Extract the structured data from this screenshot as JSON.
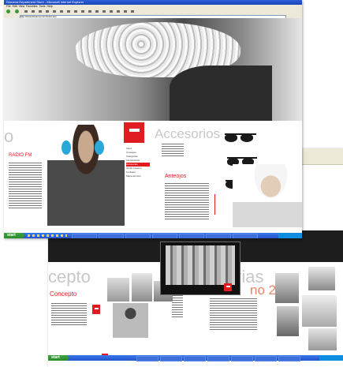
{
  "back_window": {
    "headings": {
      "left": "cepto",
      "middle": "rias",
      "right": "no 2005"
    },
    "left_red_heading": "Concepto",
    "taskbar": {
      "start_label": "start",
      "items": [
        "",
        "",
        "",
        "",
        "",
        "",
        "",
        ""
      ]
    }
  },
  "front_window": {
    "title": "Diorama Department Store - Microsoft Internet Explorer",
    "menu": [
      "File",
      "Edit",
      "View",
      "Favorites",
      "Tools",
      "Help"
    ],
    "address": "http://www.diorama.com/index.asp",
    "page": {
      "left_heading": "o",
      "left_red_text": "RADIO FM",
      "section_heading": "Accesorios",
      "red_subheading": "Anteojos",
      "nav_items": [
        "Inicio",
        "Concepto",
        "Categorias",
        "Lanzamiento",
        "Accesorios",
        "Otoño-Invierno",
        "Contacto",
        "Mapa del sitio"
      ]
    },
    "taskbar": {
      "start_label": "start"
    }
  },
  "colors": {
    "accent_red": "#e01b22",
    "xp_blue": "#2455cc",
    "xp_green": "#3fa33f"
  }
}
